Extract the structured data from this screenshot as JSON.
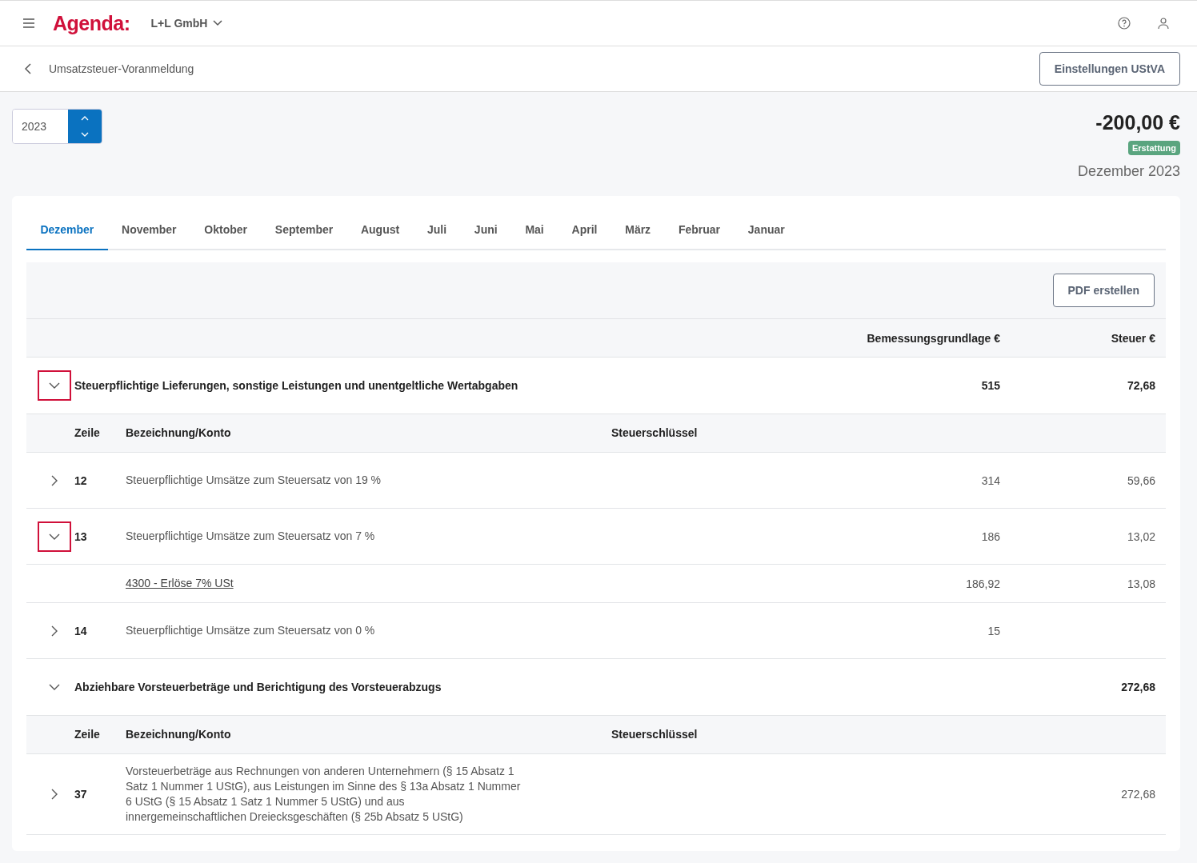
{
  "header": {
    "logo": "Agenda:",
    "company": "L+L GmbH"
  },
  "subheader": {
    "title": "Umsatzsteuer-Voranmeldung",
    "button": "Einstellungen UStVA"
  },
  "year": {
    "value": "2023"
  },
  "summary": {
    "amount": "-200,00 €",
    "badge": "Erstattung",
    "period": "Dezember 2023"
  },
  "tabs": [
    {
      "label": "Dezember",
      "selected": true
    },
    {
      "label": "November",
      "selected": false
    },
    {
      "label": "Oktober",
      "selected": false
    },
    {
      "label": "September",
      "selected": false
    },
    {
      "label": "August",
      "selected": false
    },
    {
      "label": "Juli",
      "selected": false
    },
    {
      "label": "Juni",
      "selected": false
    },
    {
      "label": "Mai",
      "selected": false
    },
    {
      "label": "April",
      "selected": false
    },
    {
      "label": "März",
      "selected": false
    },
    {
      "label": "Februar",
      "selected": false
    },
    {
      "label": "Januar",
      "selected": false
    }
  ],
  "pdf_button": "PDF erstellen",
  "table": {
    "columns": {
      "base": "Bemessungsgrundlage €",
      "tax": "Steuer €"
    },
    "sections": [
      {
        "title": "Steuerpflichtige Lieferungen, sonstige Leistungen und unentgeltliche Wertabgaben",
        "base": "515",
        "tax": "72,68",
        "expanded": true,
        "highlighted": true,
        "columns": {
          "line": "Zeile",
          "label": "Bezeichnung/Konto",
          "key": "Steuerschlüssel"
        },
        "rows": [
          {
            "line": "12",
            "label": "Steuerpflichtige Umsätze zum Steuersatz von 19 %",
            "base": "314",
            "tax": "59,66",
            "expanded": false,
            "highlighted": false
          },
          {
            "line": "13",
            "label": "Steuerpflichtige Umsätze zum Steuersatz von 7 %",
            "base": "186",
            "tax": "13,02",
            "expanded": true,
            "highlighted": true,
            "accounts": [
              {
                "label": "4300 - Erlöse 7% USt",
                "base": "186,92",
                "tax": "13,08"
              }
            ]
          },
          {
            "line": "14",
            "label": "Steuerpflichtige Umsätze zum Steuersatz von 0 %",
            "base": "15",
            "expanded": false,
            "highlighted": false
          }
        ]
      },
      {
        "title": "Abziehbare Vorsteuerbeträge und Berichtigung des Vorsteuerabzugs",
        "tax": "272,68",
        "expanded": true,
        "highlighted": false,
        "columns": {
          "line": "Zeile",
          "label": "Bezeichnung/Konto",
          "key": "Steuerschlüssel"
        },
        "rows": [
          {
            "line": "37",
            "label": "Vorsteuerbeträge aus Rechnungen von anderen Unternehmern (§ 15 Absatz 1 Satz 1 Nummer 1 UStG), aus Leistungen im Sinne des § 13a Absatz 1 Nummer 6 UStG (§ 15 Absatz 1 Satz 1 Nummer 5 UStG) und aus innergemeinschaftlichen Dreiecksgeschäften (§ 25b Absatz 5 UStG)",
            "tax": "272,68",
            "expanded": false,
            "highlighted": false
          }
        ]
      }
    ]
  }
}
